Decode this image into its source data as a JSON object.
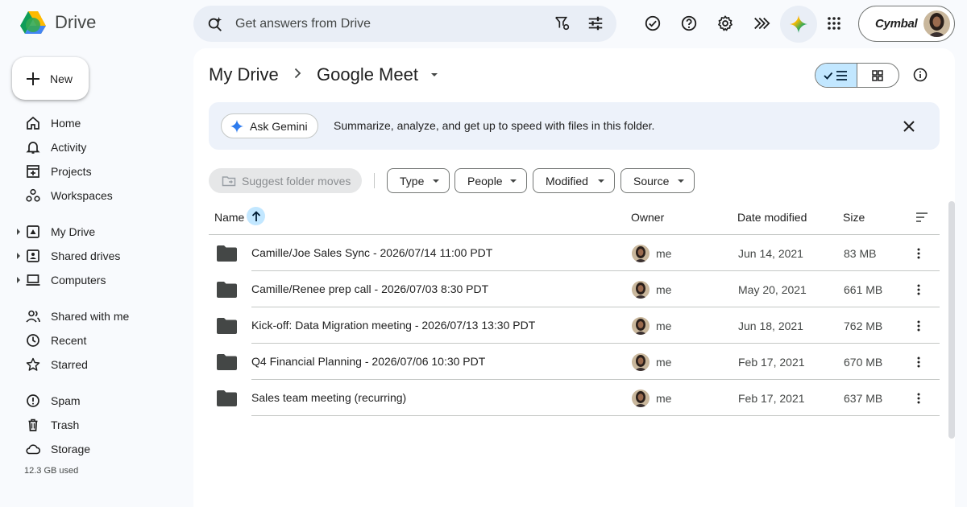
{
  "app": {
    "name": "Drive"
  },
  "search": {
    "placeholder": "Get answers from Drive"
  },
  "account": {
    "brand": "Cymbal"
  },
  "sidebar": {
    "new_label": "New",
    "items": [
      {
        "label": "Home",
        "icon": "home-icon"
      },
      {
        "label": "Activity",
        "icon": "bell-icon"
      },
      {
        "label": "Projects",
        "icon": "project-icon"
      },
      {
        "label": "Workspaces",
        "icon": "workspaces-icon"
      },
      {
        "label": "My Drive",
        "icon": "my-drive-icon"
      },
      {
        "label": "Shared drives",
        "icon": "shared-drives-icon"
      },
      {
        "label": "Computers",
        "icon": "computer-icon"
      },
      {
        "label": "Shared with me",
        "icon": "people-icon"
      },
      {
        "label": "Recent",
        "icon": "clock-icon"
      },
      {
        "label": "Starred",
        "icon": "star-icon"
      },
      {
        "label": "Spam",
        "icon": "spam-icon"
      },
      {
        "label": "Trash",
        "icon": "trash-icon"
      },
      {
        "label": "Storage",
        "icon": "cloud-icon"
      }
    ],
    "storage_used": "12.3 GB used"
  },
  "breadcrumb": {
    "root": "My Drive",
    "current": "Google Meet"
  },
  "gemini_banner": {
    "button_label": "Ask Gemini",
    "text": "Summarize, analyze, and get up to speed with files in this folder."
  },
  "filters": {
    "suggest": "Suggest folder moves",
    "chips": [
      "Type",
      "People",
      "Modified",
      "Source"
    ]
  },
  "table": {
    "headers": {
      "name": "Name",
      "owner": "Owner",
      "date": "Date modified",
      "size": "Size"
    },
    "rows": [
      {
        "name": "Camille/Joe Sales Sync - 2026/07/14 11:00 PDT",
        "owner": "me",
        "date": "Jun 14, 2021",
        "size": "83 MB"
      },
      {
        "name": "Camille/Renee prep call - 2026/07/03 8:30 PDT",
        "owner": "me",
        "date": "May 20, 2021",
        "size": "661 MB"
      },
      {
        "name": "Kick-off: Data Migration meeting - 2026/07/13 13:30 PDT",
        "owner": "me",
        "date": "Jun 18, 2021",
        "size": "762 MB"
      },
      {
        "name": "Q4 Financial Planning - 2026/07/06 10:30 PDT",
        "owner": "me",
        "date": "Feb 17, 2021",
        "size": "670 MB"
      },
      {
        "name": "Sales team meeting (recurring)",
        "owner": "me",
        "date": "Feb 17, 2021",
        "size": "637 MB"
      }
    ]
  },
  "colors": {
    "accent": "#c2e7ff",
    "surface": "#f8fafd",
    "banner": "#edf2fa"
  }
}
